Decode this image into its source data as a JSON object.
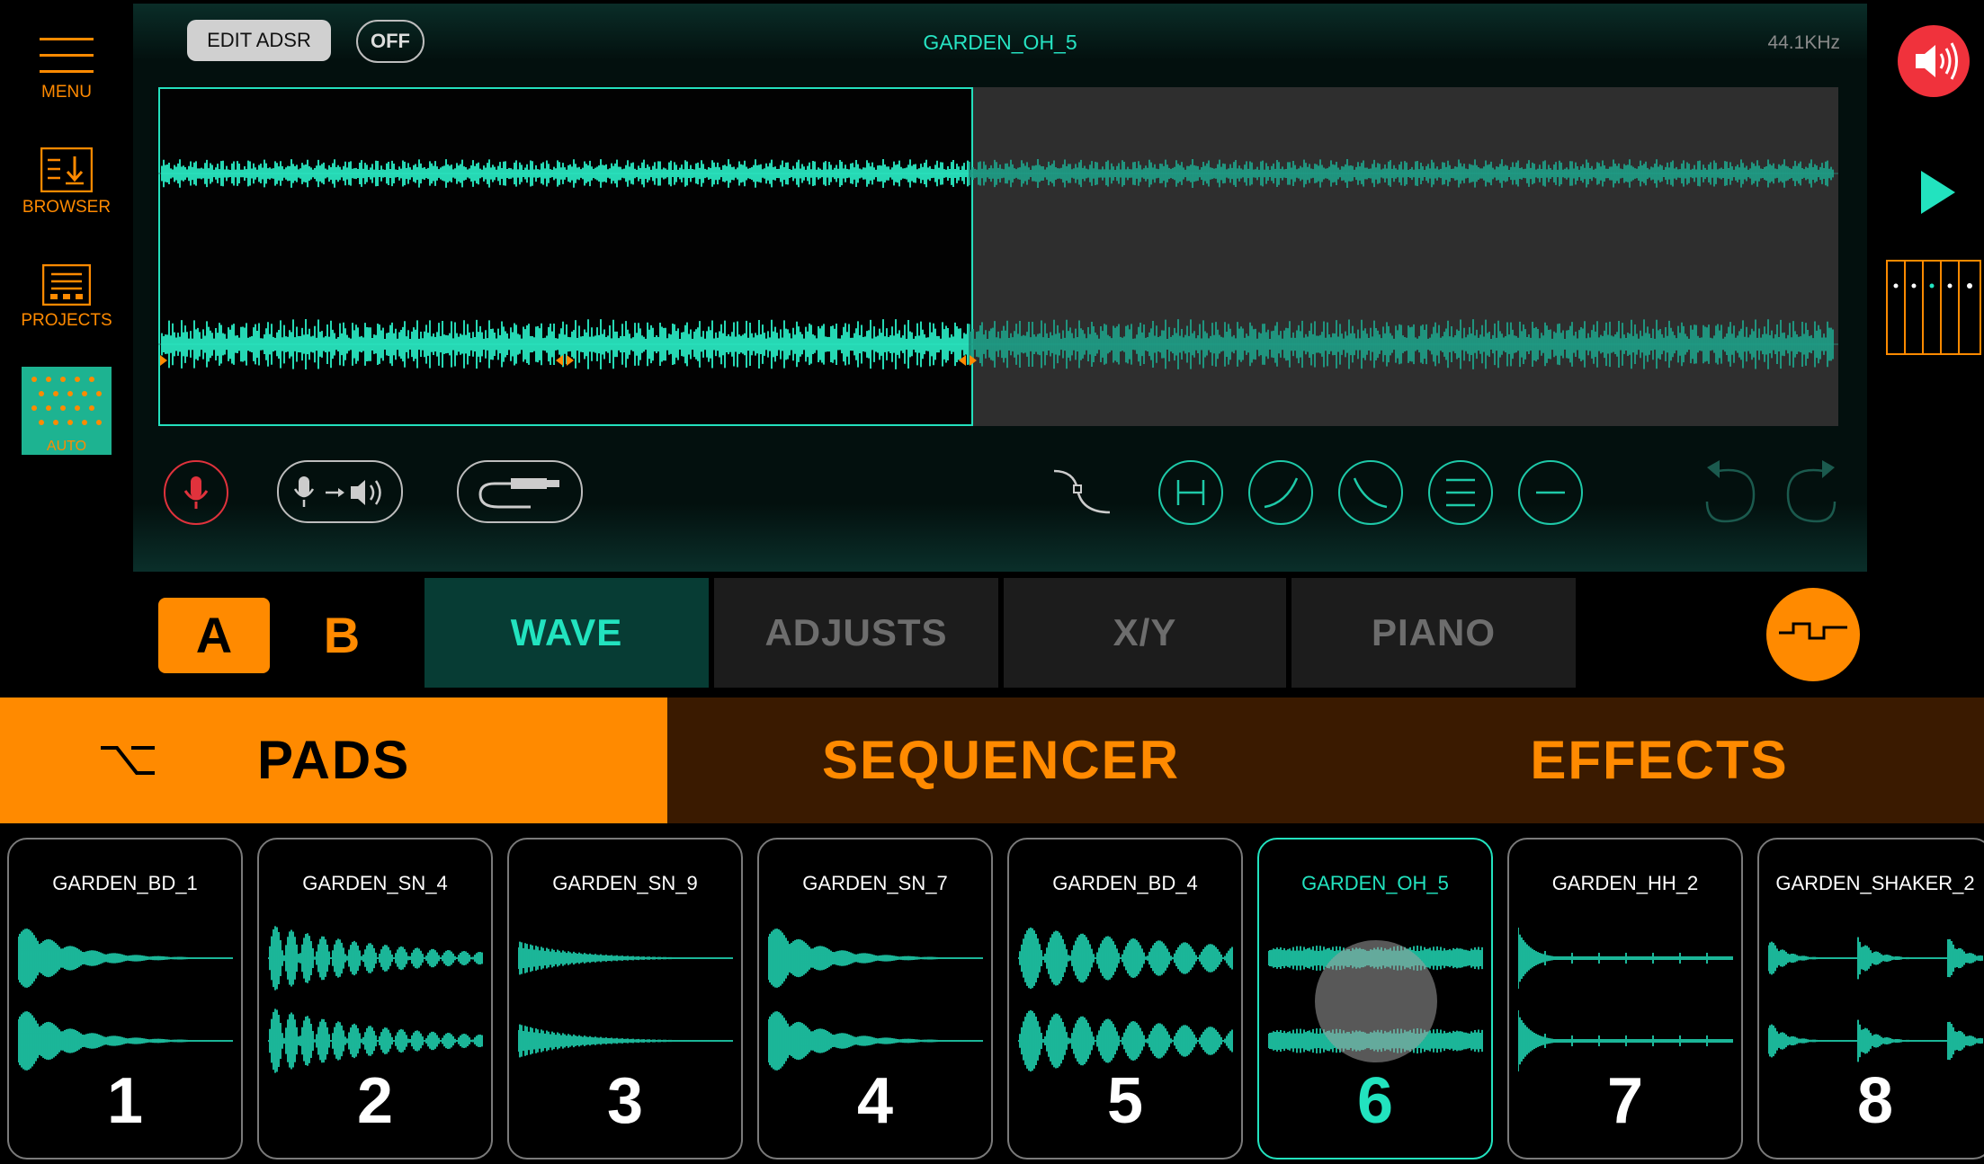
{
  "sidebar": {
    "menu_label": "MENU",
    "browser_label": "BROWSER",
    "projects_label": "PROJECTS",
    "auto_label": "AUTO"
  },
  "editor": {
    "edit_adsr_label": "EDIT ADSR",
    "off_label": "OFF",
    "sample_name": "GARDEN_OH_5",
    "sample_rate": "44.1KHz"
  },
  "bank": {
    "a_label": "A",
    "b_label": "B",
    "selected": "A"
  },
  "tabs": [
    {
      "label": "WAVE",
      "active": true
    },
    {
      "label": "ADJUSTS",
      "active": false
    },
    {
      "label": "X/Y",
      "active": false
    },
    {
      "label": "PIANO",
      "active": false
    }
  ],
  "sections": [
    {
      "label": "PADS",
      "active": true
    },
    {
      "label": "SEQUENCER",
      "active": false
    },
    {
      "label": "EFFECTS",
      "active": false
    }
  ],
  "pads": [
    {
      "name": "GARDEN_BD_1",
      "number": "1",
      "active": false
    },
    {
      "name": "GARDEN_SN_4",
      "number": "2",
      "active": false
    },
    {
      "name": "GARDEN_SN_9",
      "number": "3",
      "active": false
    },
    {
      "name": "GARDEN_SN_7",
      "number": "4",
      "active": false
    },
    {
      "name": "GARDEN_BD_4",
      "number": "5",
      "active": false
    },
    {
      "name": "GARDEN_OH_5",
      "number": "6",
      "active": true
    },
    {
      "name": "GARDEN_HH_2",
      "number": "7",
      "active": false
    },
    {
      "name": "GARDEN_SHAKER_2",
      "number": "8",
      "active": false
    }
  ],
  "colors": {
    "accent_orange": "#ff8a00",
    "wave_teal": "#23e0bd",
    "speaker_red": "#f0323c"
  },
  "icons": [
    "menu-icon",
    "browser-icon",
    "projects-icon",
    "speaker-icon",
    "play-icon",
    "mixer-icon",
    "mic-icon",
    "monitor-icon",
    "cable-icon",
    "curve-icon",
    "normalize-icon",
    "fade-in-icon",
    "fade-out-icon",
    "trim-icon",
    "silence-icon",
    "undo-icon",
    "redo-icon",
    "quantize-icon",
    "pads-switch-icon"
  ]
}
